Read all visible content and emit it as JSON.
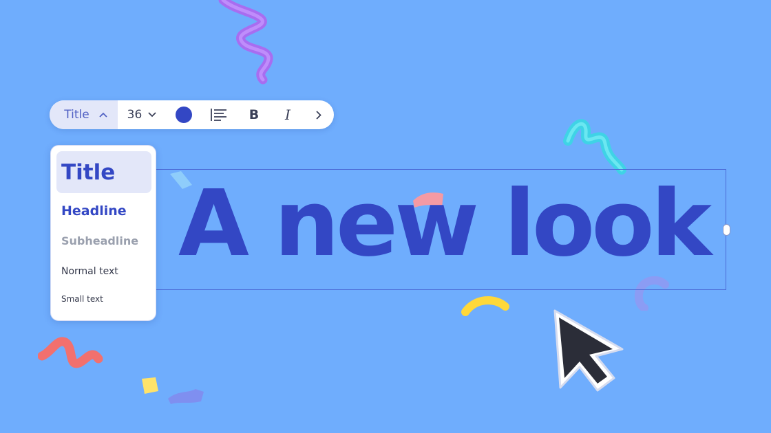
{
  "toolbar": {
    "style_label": "Title",
    "font_size": "36",
    "text_color": "#3347c4",
    "icons": {
      "style_toggle": "chevron-up-icon",
      "size_toggle": "chevron-down-icon",
      "align": "align-left-icon",
      "bold": "bold-icon",
      "italic": "italic-icon",
      "more": "chevron-right-icon"
    },
    "bold_glyph": "B",
    "italic_glyph": "I"
  },
  "style_menu": {
    "items": [
      {
        "label": "Title",
        "selected": true
      },
      {
        "label": "Headline"
      },
      {
        "label": "Subheadline"
      },
      {
        "label": "Normal text"
      },
      {
        "label": "Small text"
      }
    ]
  },
  "canvas": {
    "headline": "A new look",
    "background": "#6fadfd",
    "accent": "#3347c4"
  }
}
